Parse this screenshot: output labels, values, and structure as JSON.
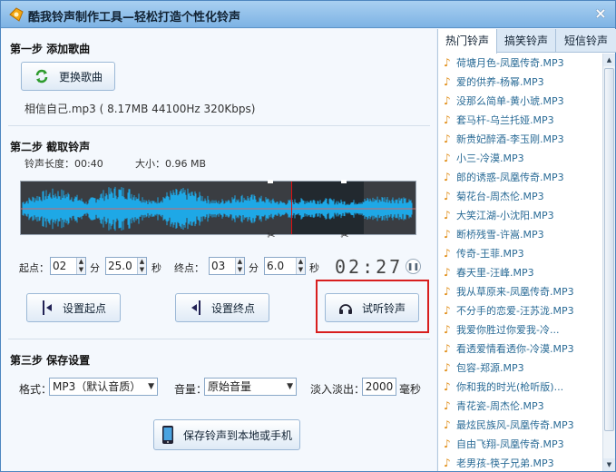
{
  "window": {
    "title": "酷我铃声制作工具—轻松打造个性化铃声",
    "close": "×"
  },
  "step1": {
    "title": "第一步  添加歌曲",
    "change_button": "更换歌曲",
    "song_info": "相信自己.mp3  ( 8.17MB 44100Hz 320Kbps)"
  },
  "step2": {
    "title": "第二步  截取铃声",
    "length_label": "铃声长度：00:40",
    "size_label": "大小：0.96 MB",
    "start_label": "起点：",
    "start_min": "02",
    "min_unit": "分",
    "start_sec": "25.0",
    "sec_unit": "秒",
    "end_label": "终点：",
    "end_min": "03",
    "end_sec": "6.0",
    "timer": "02:27",
    "set_start_button": "设置起点",
    "set_end_button": "设置终点",
    "preview_button": "试听铃声"
  },
  "step3": {
    "title": "第三步  保存设置",
    "format_label": "格式：",
    "format_value": "MP3（默认音质）",
    "volume_label": "音量：",
    "volume_value": "原始音量",
    "fade_label": "淡入淡出：",
    "fade_value": "2000",
    "fade_unit": "毫秒",
    "save_button": "保存铃声到本地或手机"
  },
  "tabs": [
    "热门铃声",
    "搞笑铃声",
    "短信铃声"
  ],
  "ringtones": [
    "荷塘月色-凤凰传奇.MP3",
    "爱的供养-杨幂.MP3",
    "没那么简单-黄小琥.MP3",
    "套马杆-乌兰托娅.MP3",
    "新贵妃醉酒-李玉刚.MP3",
    "小三-冷漠.MP3",
    "郎的诱惑-凤凰传奇.MP3",
    "菊花台-周杰伦.MP3",
    "大笑江湖-小沈阳.MP3",
    "断桥残雪-许嵩.MP3",
    "传奇-王菲.MP3",
    "春天里-汪峰.MP3",
    "我从草原来-凤凰传奇.MP3",
    "不分手的恋爱-汪苏泷.MP3",
    "我爱你胜过你爱我-冷...",
    "看透爱情看透你-冷漠.MP3",
    "包容-郑源.MP3",
    "你和我的时光(枪听版)...",
    "青花瓷-周杰伦.MP3",
    "最炫民族风-凤凰传奇.MP3",
    "自由飞翔-凤凰传奇.MP3",
    "老男孩-筷子兄弟.MP3"
  ],
  "colors": {
    "accent": "#2a6b96",
    "highlight_box": "#d81e1e",
    "waveform": "#1ea8e6"
  }
}
